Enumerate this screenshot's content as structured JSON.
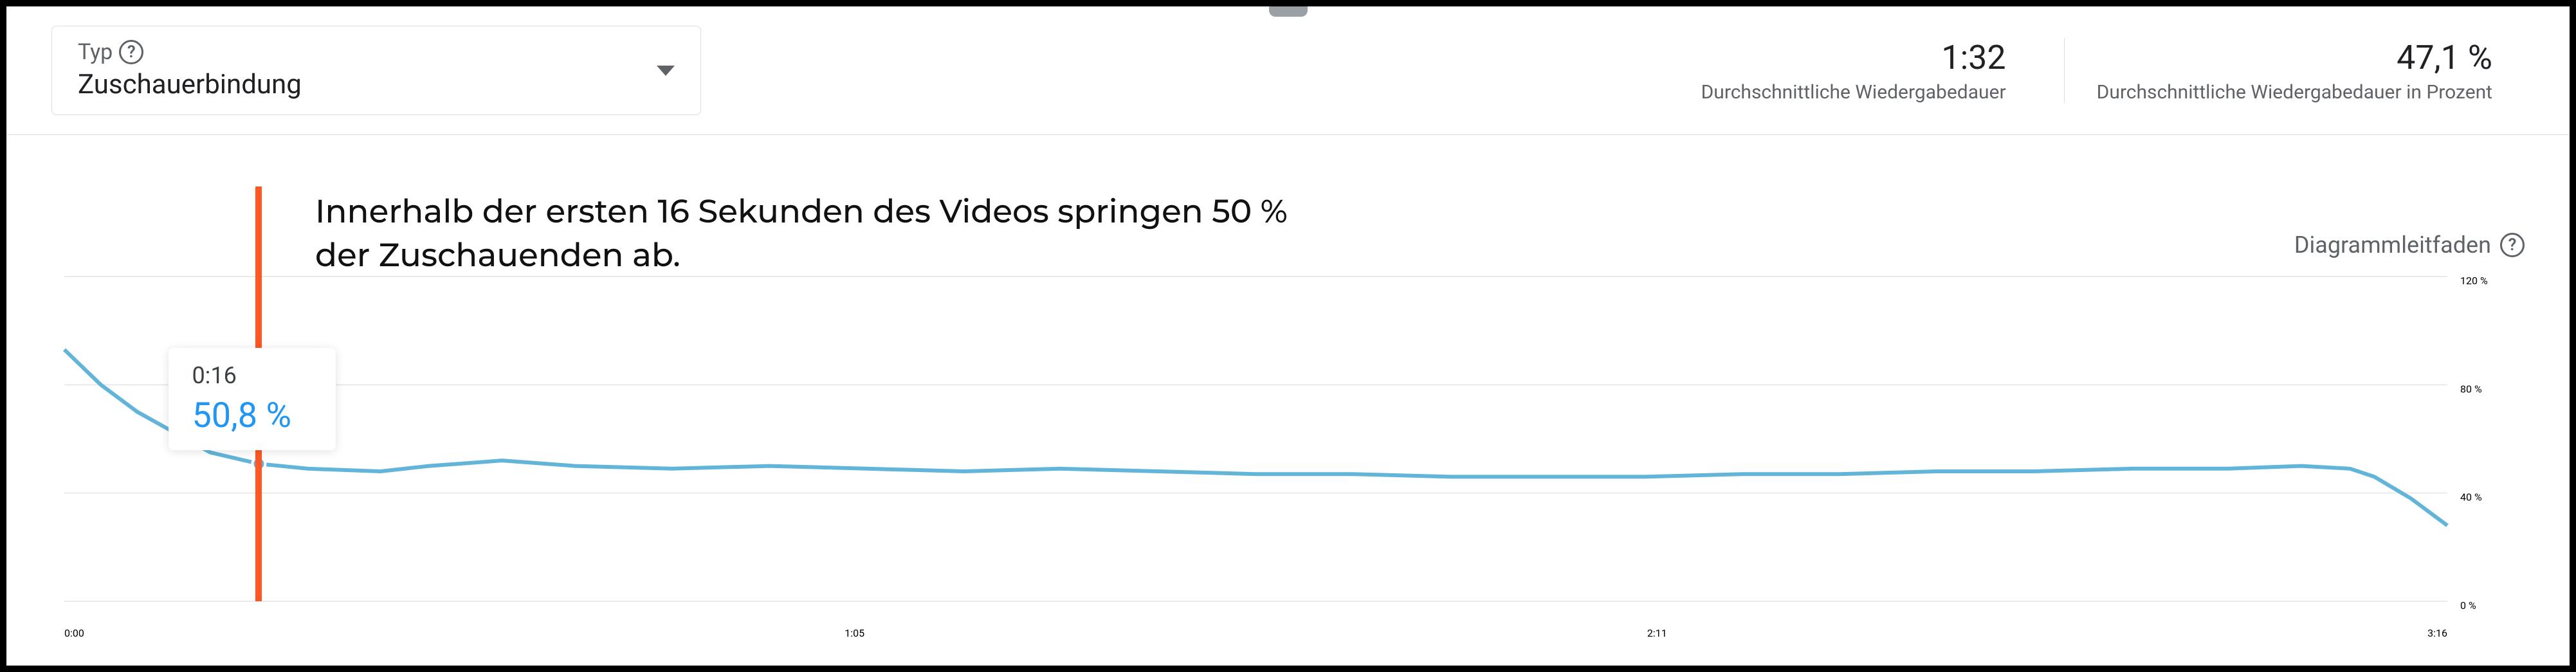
{
  "type_selector": {
    "label": "Typ",
    "value": "Zuschauerbindung"
  },
  "metrics": [
    {
      "value": "1:32",
      "label": "Durchschnittliche Wiedergabedauer"
    },
    {
      "value": "47,1 %",
      "label": "Durchschnittliche Wiedergabedauer in Prozent"
    }
  ],
  "guide_link": "Diagrammleitfaden",
  "annotation": "Innerhalb der ersten 16 Sekunden des Videos springen 50 % der Zuschauenden ab.",
  "tooltip": {
    "time": "0:16",
    "value": "50,8 %"
  },
  "xaxis": {
    "ticks": [
      "0:00",
      "1:05",
      "2:11",
      "3:16"
    ]
  },
  "yaxis": {
    "ticks": [
      "0 %",
      "40 %",
      "80 %",
      "120 %"
    ]
  },
  "chart_data": {
    "type": "line",
    "title": "Zuschauerbindung",
    "xlabel": "",
    "ylabel": "",
    "x_unit": "seconds",
    "x_range_sec": [
      0,
      196
    ],
    "ylim": [
      0,
      120
    ],
    "x_tick_labels": [
      "0:00",
      "1:05",
      "2:11",
      "3:16"
    ],
    "y_tick_labels": [
      "0 %",
      "40 %",
      "80 %",
      "120 %"
    ],
    "marker": {
      "x_sec": 16,
      "label": "0:16",
      "value_pct": 50.8
    },
    "series": [
      {
        "name": "Zuschauerbindung",
        "points": [
          {
            "x_sec": 0,
            "pct": 93
          },
          {
            "x_sec": 3,
            "pct": 80
          },
          {
            "x_sec": 6,
            "pct": 70
          },
          {
            "x_sec": 10,
            "pct": 60
          },
          {
            "x_sec": 12,
            "pct": 55
          },
          {
            "x_sec": 16,
            "pct": 50.8
          },
          {
            "x_sec": 20,
            "pct": 49
          },
          {
            "x_sec": 26,
            "pct": 48
          },
          {
            "x_sec": 30,
            "pct": 50
          },
          {
            "x_sec": 36,
            "pct": 52
          },
          {
            "x_sec": 42,
            "pct": 50
          },
          {
            "x_sec": 50,
            "pct": 49
          },
          {
            "x_sec": 58,
            "pct": 50
          },
          {
            "x_sec": 66,
            "pct": 49
          },
          {
            "x_sec": 74,
            "pct": 48
          },
          {
            "x_sec": 82,
            "pct": 49
          },
          {
            "x_sec": 90,
            "pct": 48
          },
          {
            "x_sec": 98,
            "pct": 47
          },
          {
            "x_sec": 106,
            "pct": 47
          },
          {
            "x_sec": 114,
            "pct": 46
          },
          {
            "x_sec": 122,
            "pct": 46
          },
          {
            "x_sec": 130,
            "pct": 46
          },
          {
            "x_sec": 138,
            "pct": 47
          },
          {
            "x_sec": 146,
            "pct": 47
          },
          {
            "x_sec": 154,
            "pct": 48
          },
          {
            "x_sec": 162,
            "pct": 48
          },
          {
            "x_sec": 170,
            "pct": 49
          },
          {
            "x_sec": 178,
            "pct": 49
          },
          {
            "x_sec": 184,
            "pct": 50
          },
          {
            "x_sec": 188,
            "pct": 49
          },
          {
            "x_sec": 190,
            "pct": 46
          },
          {
            "x_sec": 193,
            "pct": 38
          },
          {
            "x_sec": 196,
            "pct": 28
          }
        ]
      }
    ]
  }
}
